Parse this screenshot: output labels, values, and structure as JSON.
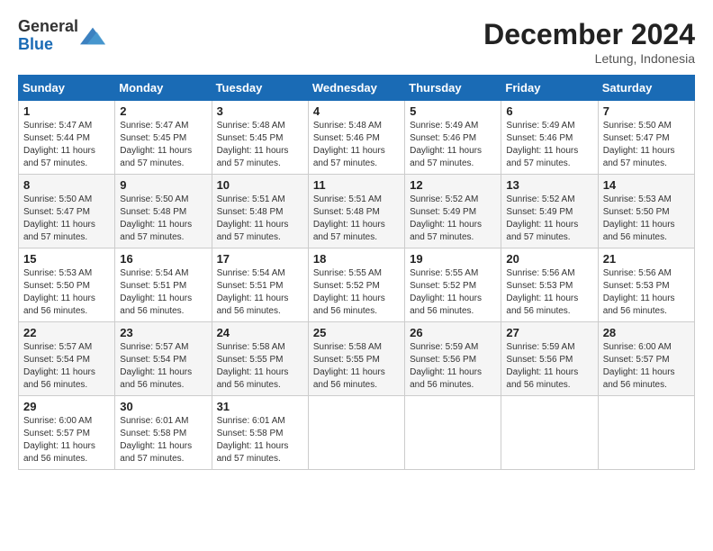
{
  "header": {
    "logo_line1": "General",
    "logo_line2": "Blue",
    "month_year": "December 2024",
    "location": "Letung, Indonesia"
  },
  "days_of_week": [
    "Sunday",
    "Monday",
    "Tuesday",
    "Wednesday",
    "Thursday",
    "Friday",
    "Saturday"
  ],
  "weeks": [
    [
      {
        "day": "1",
        "sunrise": "Sunrise: 5:47 AM",
        "sunset": "Sunset: 5:44 PM",
        "daylight": "Daylight: 11 hours and 57 minutes."
      },
      {
        "day": "2",
        "sunrise": "Sunrise: 5:47 AM",
        "sunset": "Sunset: 5:45 PM",
        "daylight": "Daylight: 11 hours and 57 minutes."
      },
      {
        "day": "3",
        "sunrise": "Sunrise: 5:48 AM",
        "sunset": "Sunset: 5:45 PM",
        "daylight": "Daylight: 11 hours and 57 minutes."
      },
      {
        "day": "4",
        "sunrise": "Sunrise: 5:48 AM",
        "sunset": "Sunset: 5:46 PM",
        "daylight": "Daylight: 11 hours and 57 minutes."
      },
      {
        "day": "5",
        "sunrise": "Sunrise: 5:49 AM",
        "sunset": "Sunset: 5:46 PM",
        "daylight": "Daylight: 11 hours and 57 minutes."
      },
      {
        "day": "6",
        "sunrise": "Sunrise: 5:49 AM",
        "sunset": "Sunset: 5:46 PM",
        "daylight": "Daylight: 11 hours and 57 minutes."
      },
      {
        "day": "7",
        "sunrise": "Sunrise: 5:50 AM",
        "sunset": "Sunset: 5:47 PM",
        "daylight": "Daylight: 11 hours and 57 minutes."
      }
    ],
    [
      {
        "day": "8",
        "sunrise": "Sunrise: 5:50 AM",
        "sunset": "Sunset: 5:47 PM",
        "daylight": "Daylight: 11 hours and 57 minutes."
      },
      {
        "day": "9",
        "sunrise": "Sunrise: 5:50 AM",
        "sunset": "Sunset: 5:48 PM",
        "daylight": "Daylight: 11 hours and 57 minutes."
      },
      {
        "day": "10",
        "sunrise": "Sunrise: 5:51 AM",
        "sunset": "Sunset: 5:48 PM",
        "daylight": "Daylight: 11 hours and 57 minutes."
      },
      {
        "day": "11",
        "sunrise": "Sunrise: 5:51 AM",
        "sunset": "Sunset: 5:48 PM",
        "daylight": "Daylight: 11 hours and 57 minutes."
      },
      {
        "day": "12",
        "sunrise": "Sunrise: 5:52 AM",
        "sunset": "Sunset: 5:49 PM",
        "daylight": "Daylight: 11 hours and 57 minutes."
      },
      {
        "day": "13",
        "sunrise": "Sunrise: 5:52 AM",
        "sunset": "Sunset: 5:49 PM",
        "daylight": "Daylight: 11 hours and 57 minutes."
      },
      {
        "day": "14",
        "sunrise": "Sunrise: 5:53 AM",
        "sunset": "Sunset: 5:50 PM",
        "daylight": "Daylight: 11 hours and 56 minutes."
      }
    ],
    [
      {
        "day": "15",
        "sunrise": "Sunrise: 5:53 AM",
        "sunset": "Sunset: 5:50 PM",
        "daylight": "Daylight: 11 hours and 56 minutes."
      },
      {
        "day": "16",
        "sunrise": "Sunrise: 5:54 AM",
        "sunset": "Sunset: 5:51 PM",
        "daylight": "Daylight: 11 hours and 56 minutes."
      },
      {
        "day": "17",
        "sunrise": "Sunrise: 5:54 AM",
        "sunset": "Sunset: 5:51 PM",
        "daylight": "Daylight: 11 hours and 56 minutes."
      },
      {
        "day": "18",
        "sunrise": "Sunrise: 5:55 AM",
        "sunset": "Sunset: 5:52 PM",
        "daylight": "Daylight: 11 hours and 56 minutes."
      },
      {
        "day": "19",
        "sunrise": "Sunrise: 5:55 AM",
        "sunset": "Sunset: 5:52 PM",
        "daylight": "Daylight: 11 hours and 56 minutes."
      },
      {
        "day": "20",
        "sunrise": "Sunrise: 5:56 AM",
        "sunset": "Sunset: 5:53 PM",
        "daylight": "Daylight: 11 hours and 56 minutes."
      },
      {
        "day": "21",
        "sunrise": "Sunrise: 5:56 AM",
        "sunset": "Sunset: 5:53 PM",
        "daylight": "Daylight: 11 hours and 56 minutes."
      }
    ],
    [
      {
        "day": "22",
        "sunrise": "Sunrise: 5:57 AM",
        "sunset": "Sunset: 5:54 PM",
        "daylight": "Daylight: 11 hours and 56 minutes."
      },
      {
        "day": "23",
        "sunrise": "Sunrise: 5:57 AM",
        "sunset": "Sunset: 5:54 PM",
        "daylight": "Daylight: 11 hours and 56 minutes."
      },
      {
        "day": "24",
        "sunrise": "Sunrise: 5:58 AM",
        "sunset": "Sunset: 5:55 PM",
        "daylight": "Daylight: 11 hours and 56 minutes."
      },
      {
        "day": "25",
        "sunrise": "Sunrise: 5:58 AM",
        "sunset": "Sunset: 5:55 PM",
        "daylight": "Daylight: 11 hours and 56 minutes."
      },
      {
        "day": "26",
        "sunrise": "Sunrise: 5:59 AM",
        "sunset": "Sunset: 5:56 PM",
        "daylight": "Daylight: 11 hours and 56 minutes."
      },
      {
        "day": "27",
        "sunrise": "Sunrise: 5:59 AM",
        "sunset": "Sunset: 5:56 PM",
        "daylight": "Daylight: 11 hours and 56 minutes."
      },
      {
        "day": "28",
        "sunrise": "Sunrise: 6:00 AM",
        "sunset": "Sunset: 5:57 PM",
        "daylight": "Daylight: 11 hours and 56 minutes."
      }
    ],
    [
      {
        "day": "29",
        "sunrise": "Sunrise: 6:00 AM",
        "sunset": "Sunset: 5:57 PM",
        "daylight": "Daylight: 11 hours and 56 minutes."
      },
      {
        "day": "30",
        "sunrise": "Sunrise: 6:01 AM",
        "sunset": "Sunset: 5:58 PM",
        "daylight": "Daylight: 11 hours and 57 minutes."
      },
      {
        "day": "31",
        "sunrise": "Sunrise: 6:01 AM",
        "sunset": "Sunset: 5:58 PM",
        "daylight": "Daylight: 11 hours and 57 minutes."
      },
      null,
      null,
      null,
      null
    ]
  ]
}
